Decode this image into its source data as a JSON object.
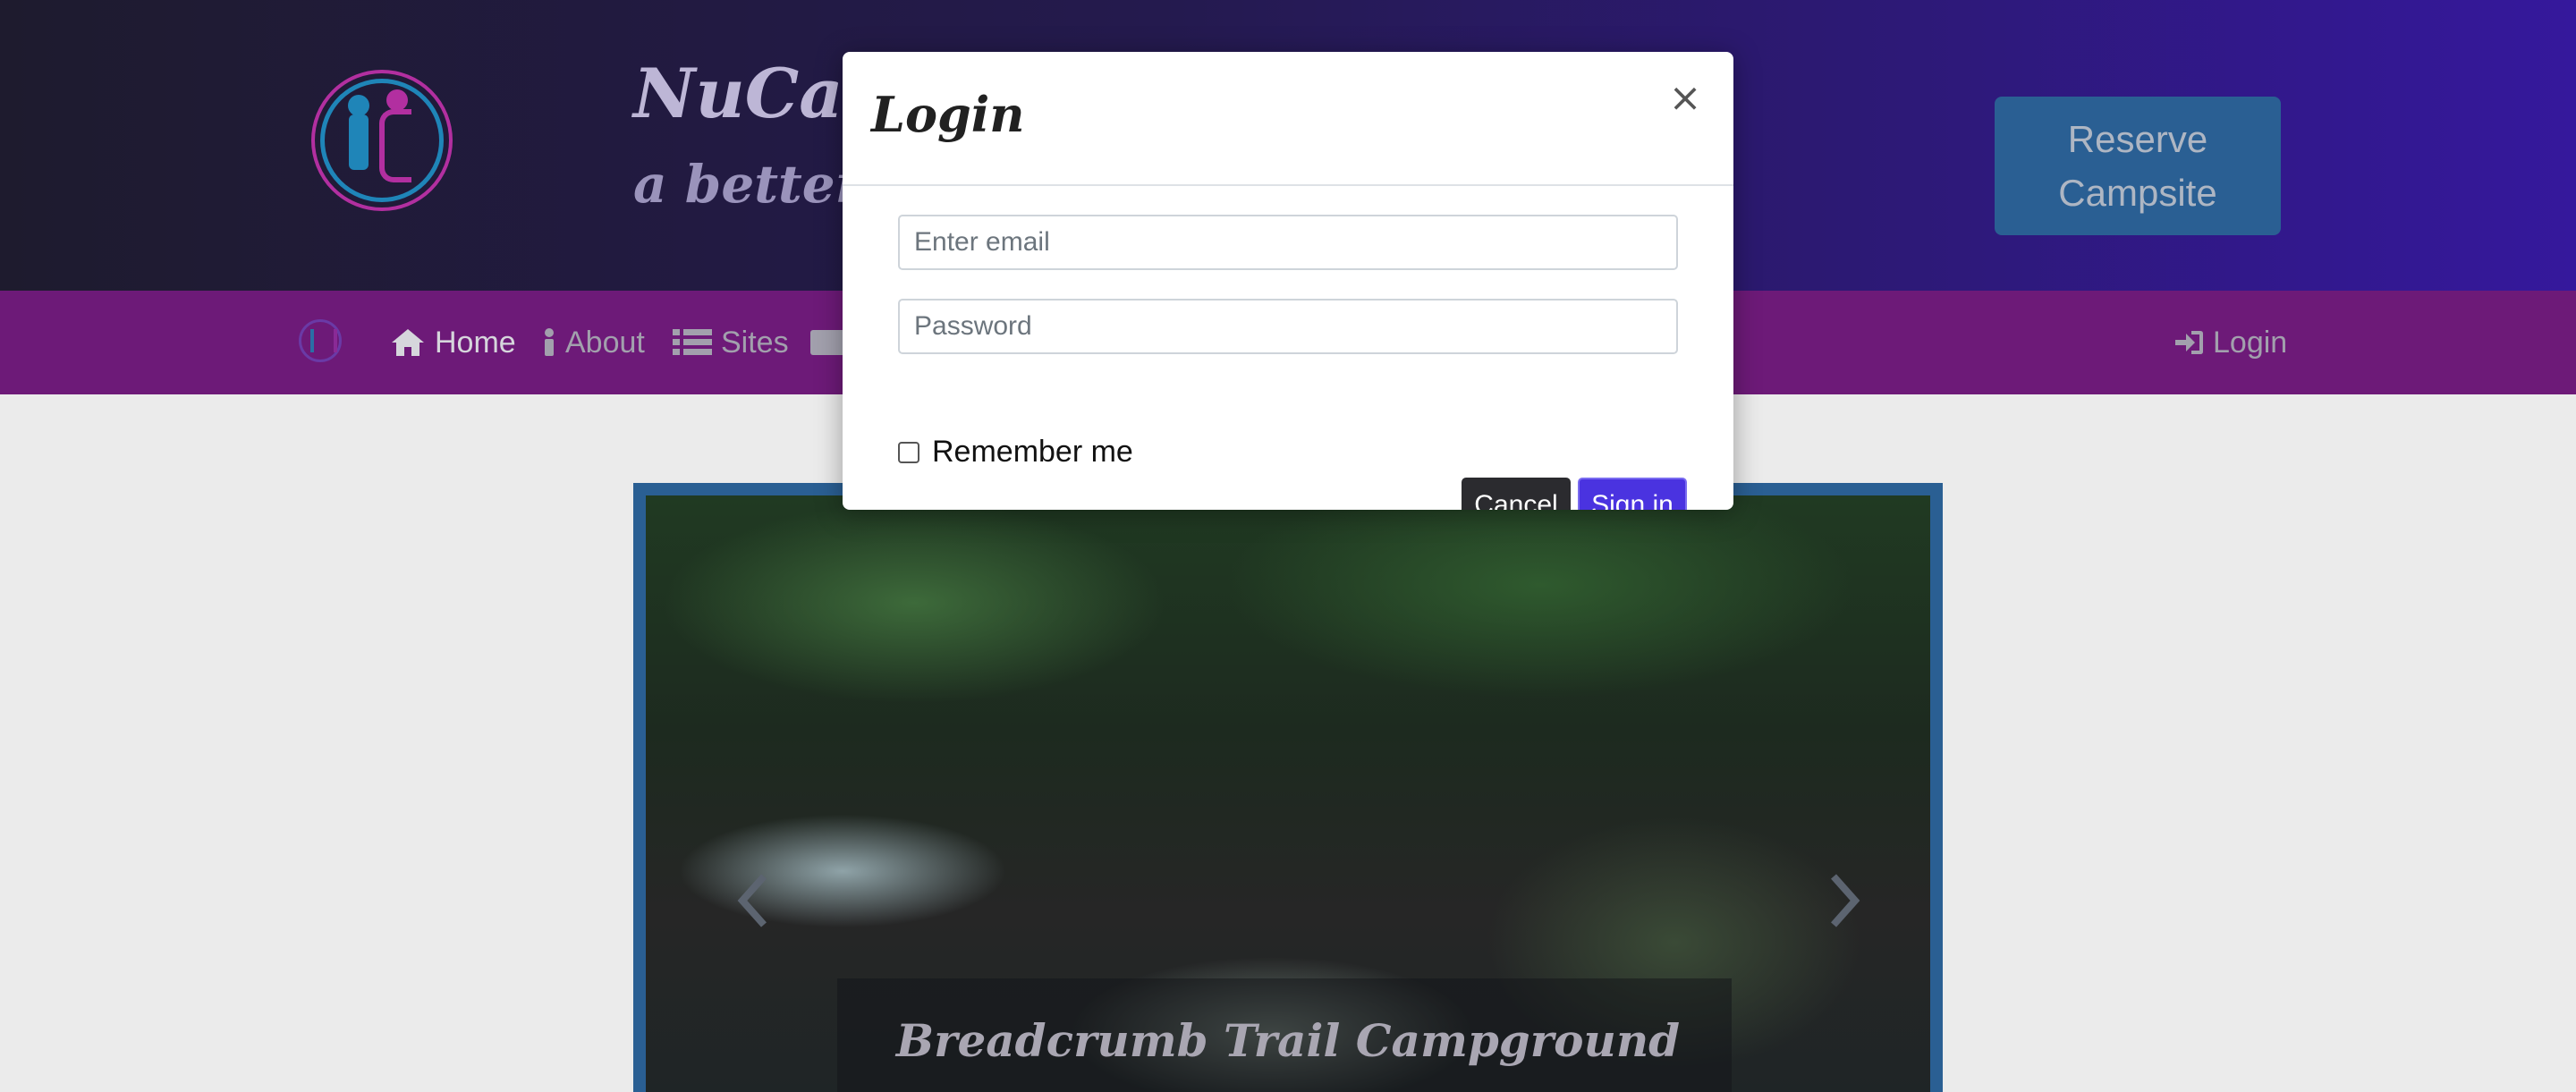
{
  "header": {
    "brand_title": "NuCamp",
    "brand_tagline": "a better w",
    "reserve_button": "Reserve Campsite"
  },
  "navbar": {
    "items": [
      {
        "label": "Home",
        "icon": "home-icon",
        "active": true
      },
      {
        "label": "About",
        "icon": "info-icon",
        "active": false
      },
      {
        "label": "Sites",
        "icon": "list-icon",
        "active": false
      },
      {
        "label": "",
        "icon": "address-card-icon",
        "active": false
      }
    ],
    "login_label": "Login"
  },
  "modal": {
    "title": "Login",
    "close_symbol": "×",
    "email_placeholder": "Enter email",
    "password_placeholder": "Password",
    "remember_label": "Remember me",
    "cancel_label": "Cancel",
    "signin_label": "Sign in"
  },
  "carousel": {
    "caption_title": "Breadcrumb Trail Campground"
  },
  "colors": {
    "navbar": "#6d1a78",
    "reserve_button": "#2a5f93",
    "signin_button": "#4a33e0",
    "cancel_button": "#2b2b2f"
  }
}
